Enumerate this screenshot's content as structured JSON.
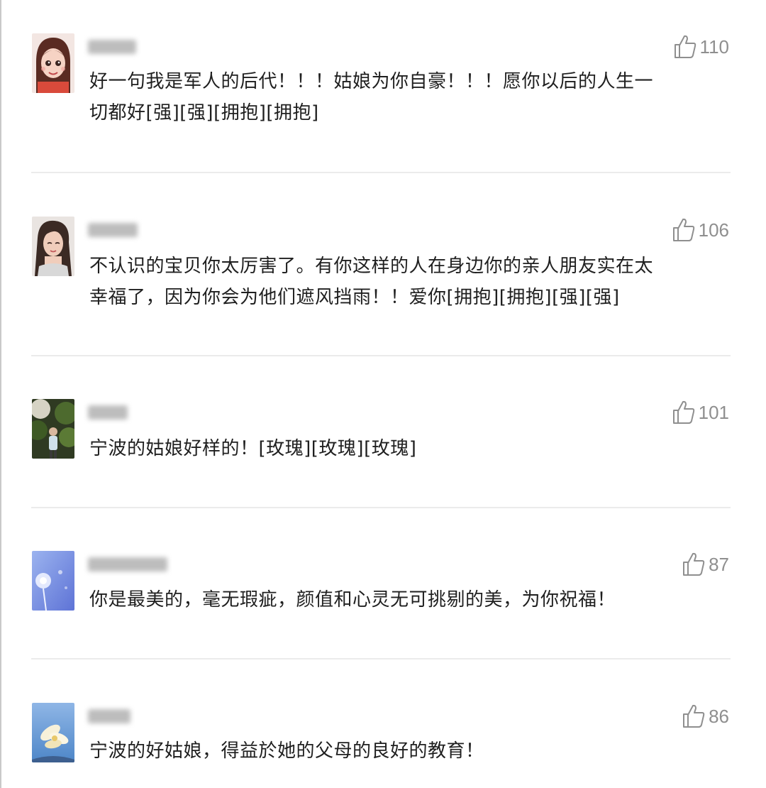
{
  "comments": [
    {
      "likes": "110",
      "text_lines": [
        "好一句我是军人的后代！！！姑娘为你自豪！！！愿你以后的人生一",
        "切都好[强][强][拥抱][拥抱]"
      ]
    },
    {
      "likes": "106",
      "text_lines": [
        "不认识的宝贝你太厉害了。有你这样的人在身边你的亲人朋友实在太",
        "幸福了，因为你会为他们遮风挡雨！！爱你[拥抱][拥抱][强][强]"
      ]
    },
    {
      "likes": "101",
      "text_lines": [
        "宁波的姑娘好样的！[玫瑰][玫瑰][玫瑰]"
      ]
    },
    {
      "likes": "87",
      "text_lines": [
        "你是最美的，毫无瑕疵，颜值和心灵无可挑剔的美，为你祝福！"
      ]
    },
    {
      "likes": "86",
      "text_lines": [
        "宁波的好姑娘，得益於她的父母的良好的教育！"
      ]
    }
  ],
  "icons": {
    "like": "thumbs-up-outline-icon"
  },
  "colors": {
    "text": "#1f1f1f",
    "like_count": "#8f8f8f",
    "divider": "#ebebeb"
  }
}
